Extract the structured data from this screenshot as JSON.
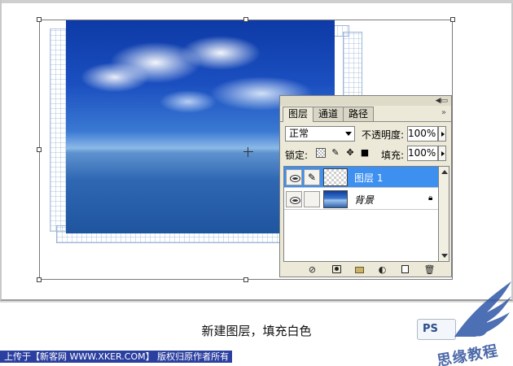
{
  "palette": {
    "tabs": [
      {
        "label": "图层",
        "active": true
      },
      {
        "label": "通道",
        "active": false
      },
      {
        "label": "路径",
        "active": false
      }
    ],
    "blend_mode": "正常",
    "opacity_label": "不透明度:",
    "opacity_value": "100%",
    "lock_label": "锁定:",
    "fill_label": "填充:",
    "fill_value": "100%",
    "layers": [
      {
        "name": "图层 1",
        "selected": true,
        "visible": true
      },
      {
        "name": "背景",
        "selected": false,
        "visible": true,
        "locked": true
      }
    ]
  },
  "icons": {
    "palette_menu": "palette-menu-icon",
    "eye": "eye-icon",
    "brush": "brush-icon",
    "lock": "lock-icon",
    "toolbar": [
      "layer-style-icon",
      "layer-mask-icon",
      "layer-group-icon",
      "adjustment-layer-icon",
      "new-layer-icon",
      "trash-icon"
    ]
  },
  "colors": {
    "selected_layer": "#3d8ff0",
    "palette_bg": "#ece9d8",
    "footer_bg": "#2b3fa0"
  },
  "caption": "新建图层，填充白色",
  "footer": "上传于【新客网 WWW.XKER.COM】 版权归原作者所有",
  "ps_logo": "PS",
  "site_logo": "思缘教程"
}
